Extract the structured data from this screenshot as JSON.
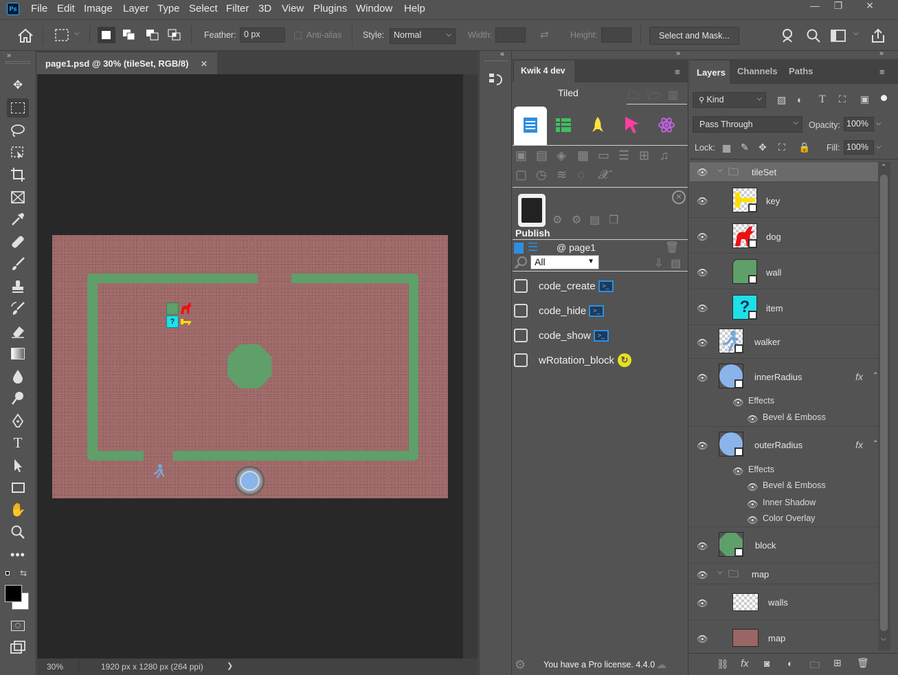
{
  "menubar": {
    "logo": "Ps",
    "items": [
      "File",
      "Edit",
      "Image",
      "Layer",
      "Type",
      "Select",
      "Filter",
      "3D",
      "View",
      "Plugins",
      "Window",
      "Help"
    ],
    "window_controls": [
      "—",
      "❐",
      "✕"
    ]
  },
  "options": {
    "feather_label": "Feather:",
    "feather_value": "0 px",
    "antialias_label": "Anti-alias",
    "style_label": "Style:",
    "style_value": "Normal",
    "width_label": "Width:",
    "height_label": "Height:",
    "select_mask_label": "Select and Mask..."
  },
  "document": {
    "tab_title": "page1.psd @ 30% (tileSet, RGB/8)",
    "close_glyph": "✕",
    "zoom": "30%",
    "dimensions": "1920 px x 1280 px (264 ppi)",
    "status_arrow": "❯"
  },
  "kwik": {
    "tab_label": "Kwik 4 dev",
    "subtitle": "Tiled",
    "publish_label": "Publish",
    "page_label": "@ page1",
    "filter_value": "All",
    "items": [
      {
        "label": "code_create",
        "badge": "terminal"
      },
      {
        "label": "code_hide",
        "badge": "terminal"
      },
      {
        "label": "code_show",
        "badge": "terminal"
      },
      {
        "label": "wRotation_block",
        "badge": "rotation"
      }
    ],
    "license_text": "You have a Pro license. 4.4.0"
  },
  "layers_panel": {
    "tabs": [
      "Layers",
      "Channels",
      "Paths"
    ],
    "kind_label": "Kind",
    "blend_mode": "Pass Through",
    "opacity_label": "Opacity:",
    "opacity_value": "100%",
    "lock_label": "Lock:",
    "fill_label": "Fill:",
    "fill_value": "100%",
    "layers": {
      "tileset": "tileSet",
      "key": "key",
      "dog": "dog",
      "wall": "wall",
      "item": "item",
      "walker": "walker",
      "inner": "innerRadius",
      "outer": "outerRadius",
      "block": "block",
      "map_group": "map",
      "walls": "walls",
      "map": "map"
    },
    "fx_label": "fx",
    "effects_label": "Effects",
    "inner_effects": [
      "Bevel & Emboss"
    ],
    "outer_effects": [
      "Bevel & Emboss",
      "Inner Shadow",
      "Color Overlay"
    ]
  },
  "colors": {
    "accent": "#31a8ff",
    "wall_green": "#5f9f6a",
    "map_red": "#9a6565"
  }
}
